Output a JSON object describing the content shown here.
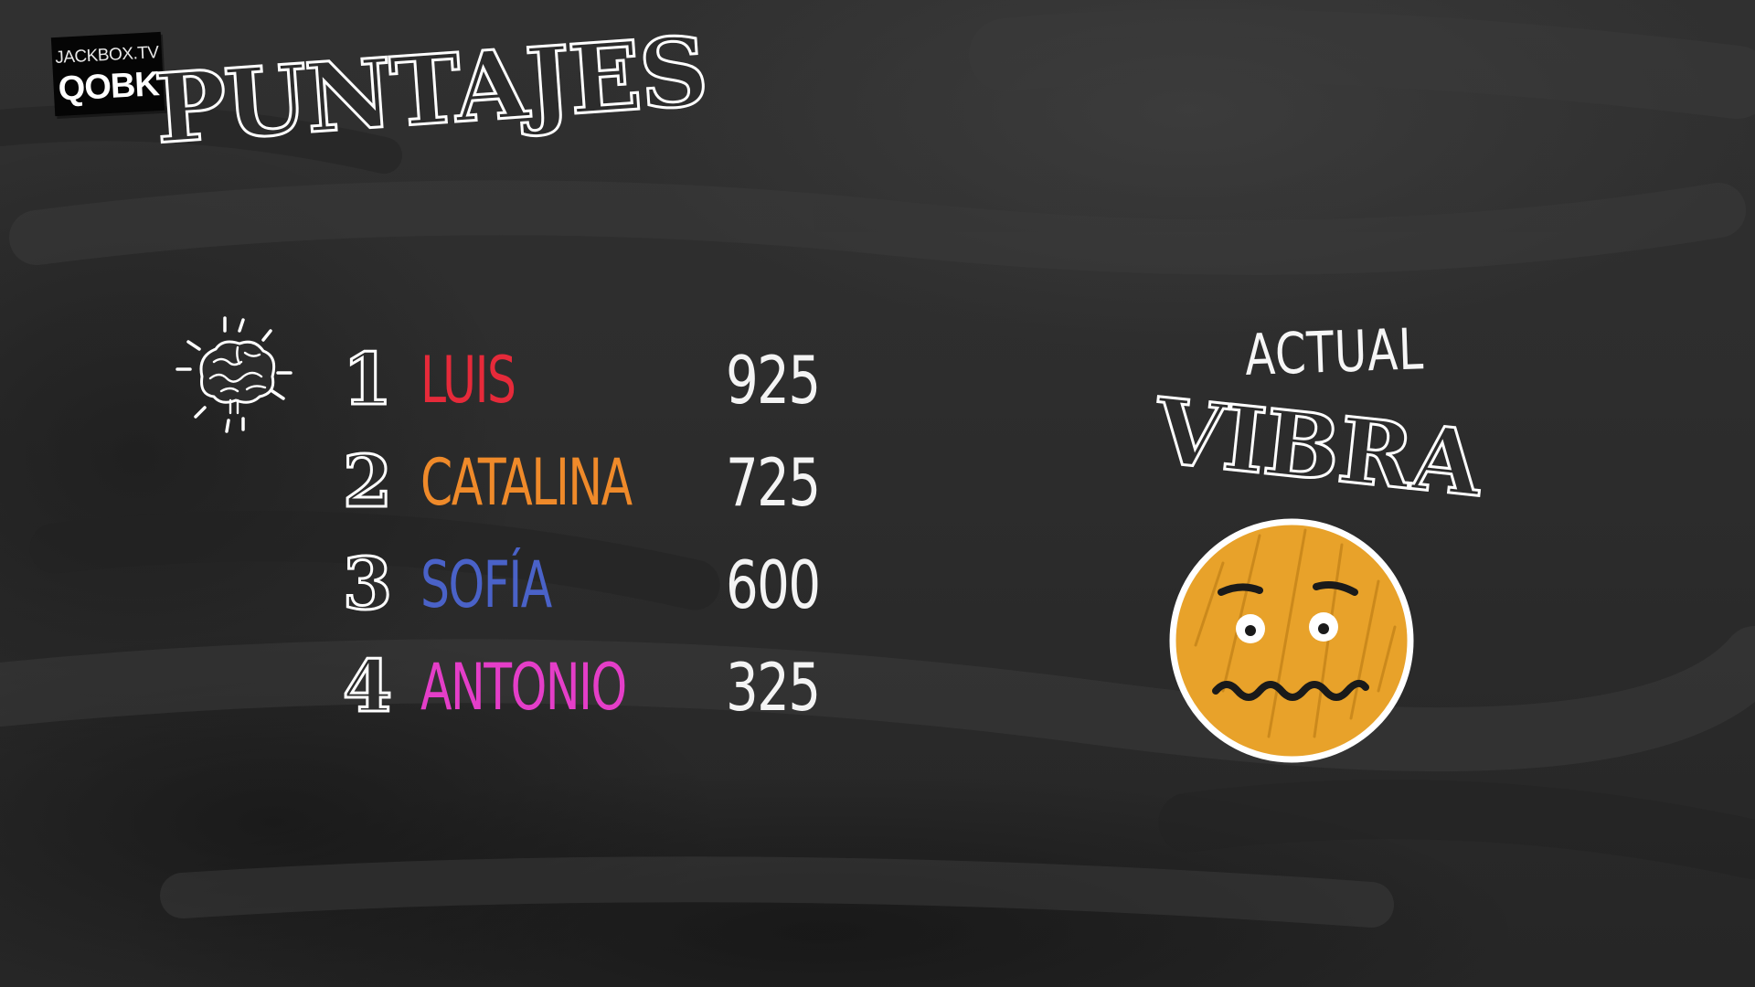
{
  "room": {
    "site": "JACKBOX.TV",
    "code": "QOBK"
  },
  "title": "PUNTAJES",
  "leaderboard": {
    "players": [
      {
        "rank": "1",
        "name": "LUIS",
        "score": "925",
        "color": "#e62a3a"
      },
      {
        "rank": "2",
        "name": "CATALINA",
        "score": "725",
        "color": "#ef8a2a"
      },
      {
        "rank": "3",
        "name": "SOFÍA",
        "score": "600",
        "color": "#4a62c8"
      },
      {
        "rank": "4",
        "name": "ANTONIO",
        "score": "325",
        "color": "#e43ec8"
      }
    ],
    "leader_icon": "brain-icon"
  },
  "vibe": {
    "caption": "ACTUAL",
    "title": "VIBRA",
    "face_icon": "nervous-face-icon",
    "face_color": "#e8a22a"
  },
  "theme": {
    "board": "#2c2c2c",
    "chalk": "#ffffff"
  }
}
